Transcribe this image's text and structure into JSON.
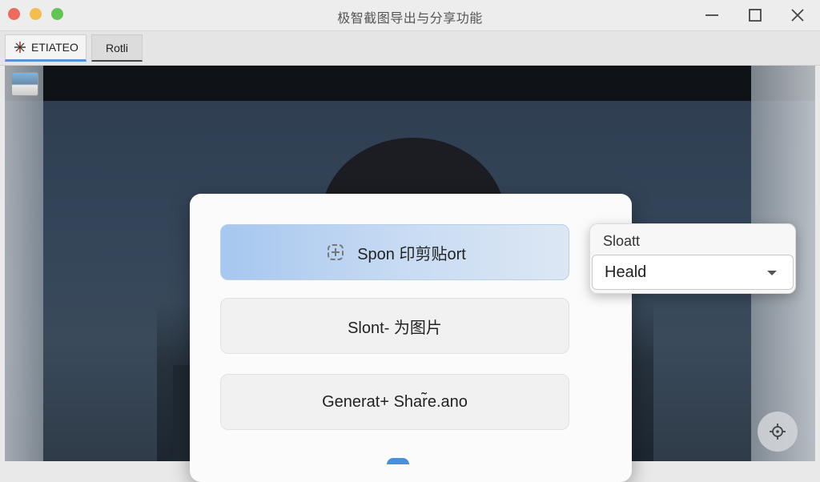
{
  "window": {
    "title": "极智截图导出与分享功能"
  },
  "tabs": [
    {
      "label": "ETIATEO",
      "active": true
    },
    {
      "label": "Rotli",
      "active": false
    }
  ],
  "dialog": {
    "options": [
      {
        "label": "Spon 印剪贴ort",
        "icon": "clipboard-icon",
        "selected": true
      },
      {
        "label": "Slont- 为图片",
        "selected": false
      },
      {
        "label": "Generat+ Shar̃e.ano",
        "selected": false
      }
    ]
  },
  "select": {
    "label": "Sloatt",
    "value": "Heald",
    "icon": "chevron-down-icon"
  },
  "canvas": {
    "locate_icon": "crosshair-icon"
  },
  "colors": {
    "accent": "#5b8fd6",
    "selected_option": "#a6c7ef",
    "red": "#ec6a5e",
    "yellow": "#f3be4f",
    "green": "#61c454"
  }
}
